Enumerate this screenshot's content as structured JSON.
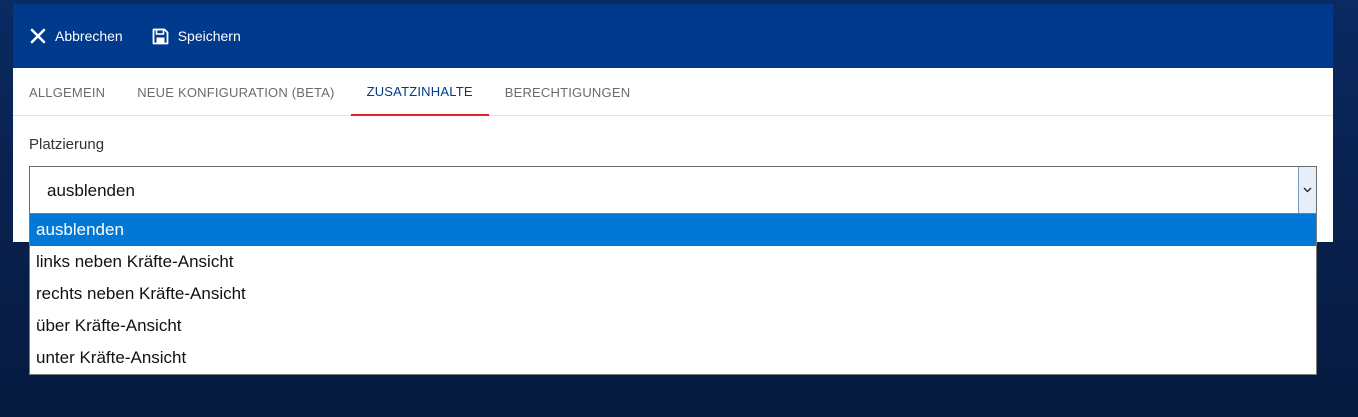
{
  "toolbar": {
    "cancel_label": "Abbrechen",
    "cancel_icon": "close-icon",
    "save_label": "Speichern",
    "save_icon": "floppy-disk-icon",
    "background": "#003a8c"
  },
  "tabs": [
    {
      "label": "ALLGEMEIN",
      "active": false
    },
    {
      "label": "NEUE KONFIGURATION (BETA)",
      "active": false
    },
    {
      "label": "ZUSATZINHALTE",
      "active": true
    },
    {
      "label": "BERECHTIGUNGEN",
      "active": false
    }
  ],
  "placement": {
    "label": "Platzierung",
    "selected_value": "ausblenden",
    "options": [
      "ausblenden",
      "links neben Kräfte-Ansicht",
      "rechts neben Kräfte-Ansicht",
      "über Kräfte-Ansicht",
      "unter Kräfte-Ansicht"
    ],
    "highlighted_index": 0
  },
  "colors": {
    "accent": "#003a8c",
    "tab_indicator": "#e0202a",
    "option_highlight": "#0078d7"
  }
}
